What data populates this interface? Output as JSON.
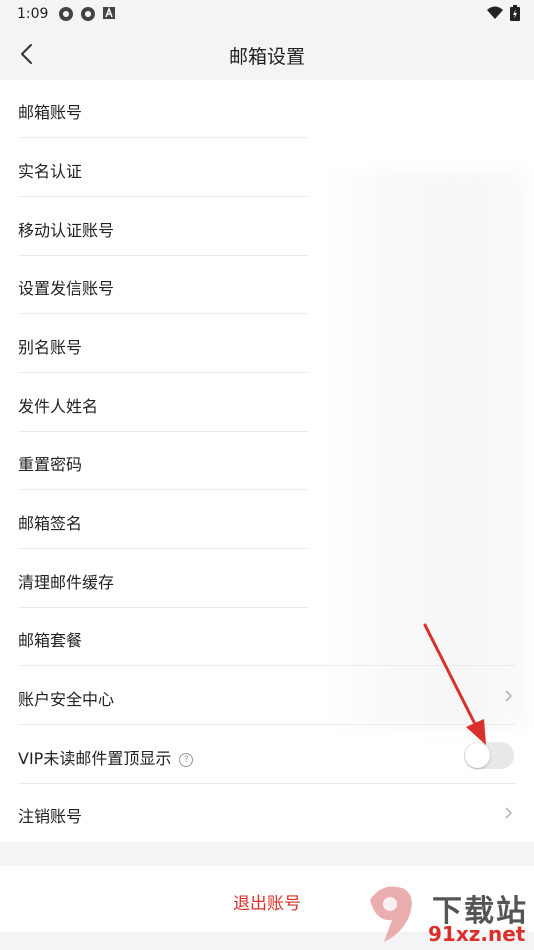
{
  "status_bar": {
    "time": "1:09"
  },
  "nav": {
    "title": "邮箱设置"
  },
  "rows": [
    {
      "label": "邮箱账号"
    },
    {
      "label": "实名认证"
    },
    {
      "label": "移动认证账号"
    },
    {
      "label": "设置发信账号"
    },
    {
      "label": "别名账号"
    },
    {
      "label": "发件人姓名"
    },
    {
      "label": "重置密码"
    },
    {
      "label": "邮箱签名"
    },
    {
      "label": "清理邮件缓存"
    },
    {
      "label": "邮箱套餐"
    },
    {
      "label": "账户安全中心"
    },
    {
      "label": "VIP未读邮件置顶显示"
    },
    {
      "label": "注销账号"
    }
  ],
  "vip_toggle": {
    "enabled": false
  },
  "logout": {
    "label": "退出账号"
  },
  "watermark": {
    "text1": "下载站",
    "text2": "91xz.net"
  },
  "colors": {
    "accent": "#d9302b",
    "background": "#f4f4f6",
    "arrow": "#d9302b"
  }
}
